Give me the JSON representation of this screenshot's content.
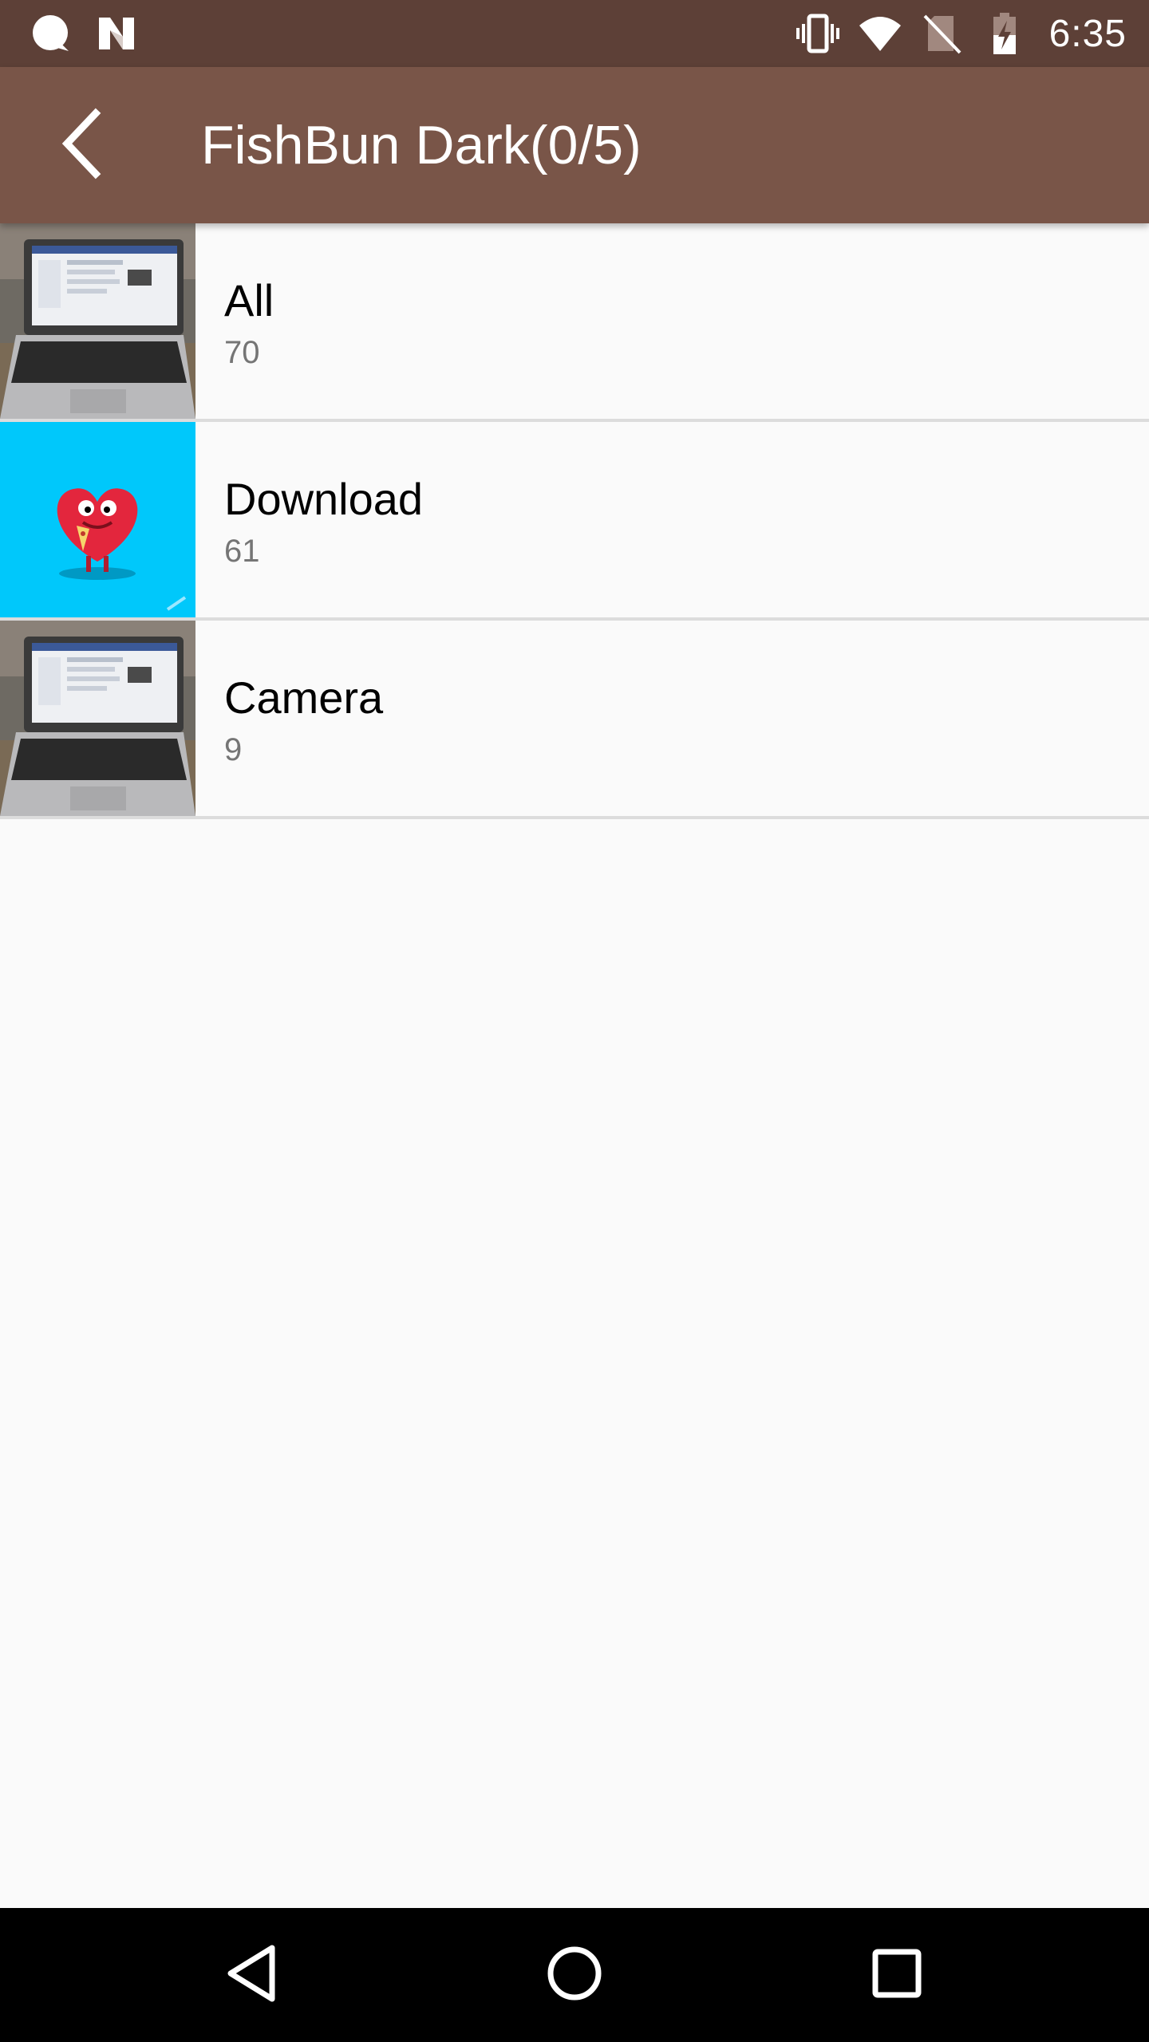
{
  "status_bar": {
    "time": "6:35",
    "icons": [
      "chat-bubble-icon",
      "n-logo-icon",
      "vibrate-icon",
      "wifi-icon",
      "no-sim-icon",
      "battery-charging-icon"
    ]
  },
  "toolbar": {
    "back_icon": "arrow-back-icon",
    "title": "FishBun Dark(0/5)"
  },
  "albums": [
    {
      "name": "All",
      "count": "70",
      "thumbnail": "laptop-photo"
    },
    {
      "name": "Download",
      "count": "61",
      "thumbnail": "heart-pizza-sticker"
    },
    {
      "name": "Camera",
      "count": "9",
      "thumbnail": "laptop-photo"
    }
  ],
  "nav_bar": {
    "buttons": [
      "back-triangle-icon",
      "home-circle-icon",
      "recents-square-icon"
    ]
  },
  "colors": {
    "status_bar": "#5d4037",
    "toolbar": "#795548",
    "background": "#fafafa",
    "divider": "#dcdcdc",
    "count_text": "#757575",
    "download_thumb_bg": "#00c8fb"
  }
}
